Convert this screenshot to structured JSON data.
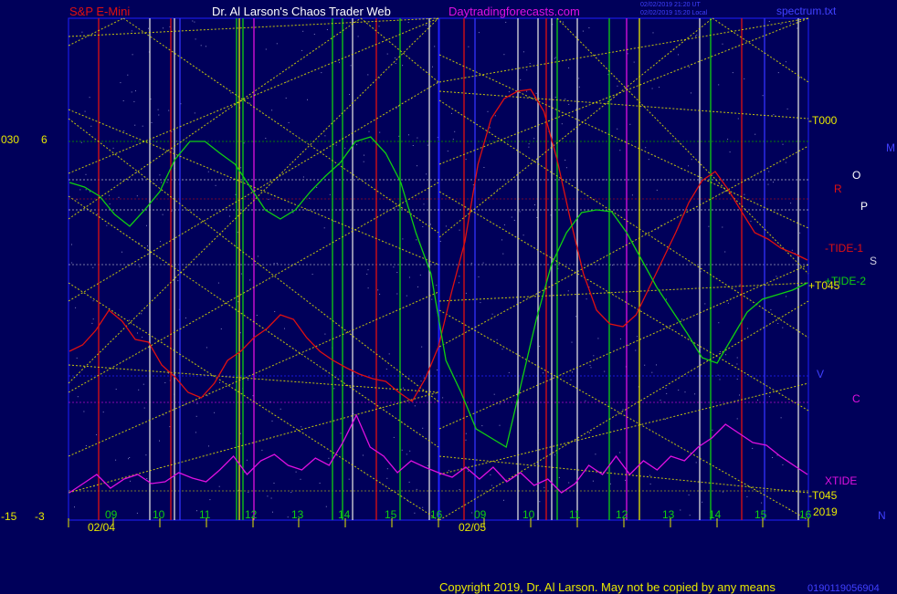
{
  "header": {
    "left": "S&P E-Mini",
    "center": "Dr. Al Larson's Chaos Trader Web",
    "site": "Daytradingforecasts.com",
    "stamp1": "02/02/2019 21:20 UT",
    "stamp2": "02/02/2019 15:20 Local",
    "right": "spectrum.txt"
  },
  "left_axis": {
    "top_a": "030",
    "top_b": "6",
    "bottom_a": "-15",
    "bottom_b": "-3"
  },
  "right_axis": {
    "n": "N",
    "year": "2019",
    "stamp": "0190119056904"
  },
  "right_labels": {
    "r": "R",
    "o": "O",
    "p": "P",
    "s": "S",
    "tide1": "-TIDE-1",
    "tide2": "+TIDE-2",
    "t045": "+T045",
    "v": "V",
    "c": "C",
    "xtide": "XTIDE",
    "t045b": "-T045",
    "t000": "-T000",
    "m": "M"
  },
  "footer": {
    "copyright": "Copyright 2019, Dr. Al Larson. May not be copied by any means"
  },
  "colors": {
    "background": "#00005a",
    "frame": "#2020ff",
    "red": "#e01010",
    "green": "#10d010",
    "magenta": "#e010e0",
    "yellow": "#e8e800",
    "white": "#ffffff"
  },
  "chart_data": {
    "type": "line",
    "title": "S&P E-Mini",
    "days": [
      "02/04",
      "02/05"
    ],
    "x_hours": [
      "09",
      "10",
      "11",
      "12",
      "13",
      "14",
      "15",
      "16"
    ],
    "day2_hours": [
      "09",
      "10",
      "11",
      "12",
      "13",
      "14",
      "15",
      "16"
    ],
    "series": [
      {
        "name": "-TIDE-1",
        "color": "#e01010",
        "values": [
          385,
          378,
          362,
          340,
          352,
          372,
          375,
          400,
          413,
          430,
          436,
          420,
          395,
          385,
          370,
          360,
          345,
          350,
          370,
          385,
          395,
          403,
          410,
          415,
          418,
          430,
          440,
          415,
          380,
          320,
          265,
          180,
          130,
          108,
          100,
          98,
          122,
          175,
          240,
          300,
          340,
          355,
          358,
          345,
          315,
          285,
          255,
          222,
          198,
          188,
          208,
          232,
          255,
          262,
          272,
          278,
          285
        ]
      },
      {
        "name": "+TIDE-2",
        "color": "#10d010",
        "values": [
          200,
          205,
          215,
          235,
          248,
          230,
          210,
          175,
          155,
          155,
          168,
          180,
          205,
          230,
          240,
          230,
          210,
          193,
          178,
          155,
          150,
          168,
          200,
          255,
          300,
          395,
          430,
          470,
          480,
          490,
          420,
          350,
          290,
          255,
          233,
          230,
          232,
          255,
          285,
          315,
          340,
          365,
          392,
          398,
          370,
          342,
          328,
          323,
          318,
          310
        ]
      },
      {
        "name": "XTIDE",
        "color": "#e010e0",
        "values": [
          540,
          530,
          520,
          535,
          525,
          520,
          530,
          528,
          518,
          524,
          528,
          515,
          500,
          520,
          505,
          498,
          510,
          515,
          502,
          510,
          485,
          455,
          490,
          500,
          518,
          505,
          512,
          518,
          523,
          512,
          525,
          512,
          528,
          518,
          532,
          525,
          540,
          530,
          510,
          520,
          500,
          520,
          505,
          515,
          500,
          505,
          490,
          480,
          465,
          475,
          485,
          488,
          500,
          510,
          520
        ]
      }
    ],
    "grid": true
  }
}
